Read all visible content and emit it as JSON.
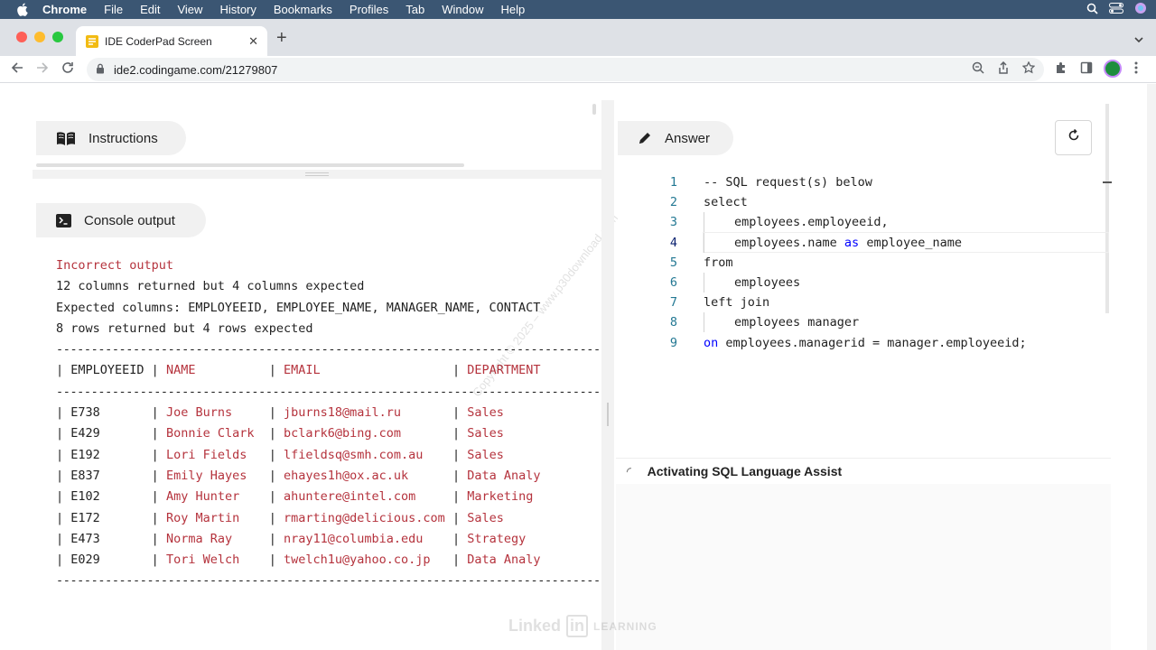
{
  "menubar": {
    "app": "Chrome",
    "items": [
      "File",
      "Edit",
      "View",
      "History",
      "Bookmarks",
      "Profiles",
      "Tab",
      "Window",
      "Help"
    ]
  },
  "browser": {
    "tab_title": "IDE CoderPad Screen",
    "url": "ide2.codingame.com/21279807"
  },
  "instructions": {
    "label": "Instructions"
  },
  "console_panel": {
    "label": "Console output",
    "error_title": "Incorrect output",
    "messages": [
      "12 columns returned but 4 columns expected",
      "Expected columns: EMPLOYEEID, EMPLOYEE_NAME, MANAGER_NAME, CONTACT",
      "8 rows returned but 4 rows expected"
    ],
    "separator": "----------------------------------------------------------------------------------",
    "columns": [
      "EMPLOYEEID",
      "NAME",
      "EMAIL",
      "DEPARTMENT"
    ],
    "rows": [
      [
        "E738",
        "Joe Burns",
        "jburns18@mail.ru",
        "Sales"
      ],
      [
        "E429",
        "Bonnie Clark",
        "bclark6@bing.com",
        "Sales"
      ],
      [
        "E192",
        "Lori Fields",
        "lfieldsq@smh.com.au",
        "Sales"
      ],
      [
        "E837",
        "Emily Hayes",
        "ehayes1h@ox.ac.uk",
        "Data Analy"
      ],
      [
        "E102",
        "Amy Hunter",
        "ahuntere@intel.com",
        "Marketing"
      ],
      [
        "E172",
        "Roy Martin",
        "rmarting@delicious.com",
        "Sales"
      ],
      [
        "E473",
        "Norma Ray",
        "nray11@columbia.edu",
        "Strategy"
      ],
      [
        "E029",
        "Tori Welch",
        "twelch1u@yahoo.co.jp",
        "Data Analy"
      ]
    ]
  },
  "answer": {
    "label": "Answer",
    "lines": [
      {
        "n": "1",
        "text": "-- SQL request(s) below"
      },
      {
        "n": "2",
        "text": "select"
      },
      {
        "n": "3",
        "text": "employees.employeeid,"
      },
      {
        "n": "4",
        "text": "employees.name as employee_name"
      },
      {
        "n": "5",
        "text": "from"
      },
      {
        "n": "6",
        "text": "employees"
      },
      {
        "n": "7",
        "text": "left join"
      },
      {
        "n": "8",
        "text": "employees manager"
      },
      {
        "n": "9",
        "text": "on employees.managerid = manager.employeeid;"
      }
    ]
  },
  "assist": {
    "label": "Activating SQL Language Assist"
  },
  "colors": {
    "error_red": "#b5333d",
    "keyword_blue": "#0000ff",
    "comment_green": "#008000",
    "line_number": "#237893"
  }
}
